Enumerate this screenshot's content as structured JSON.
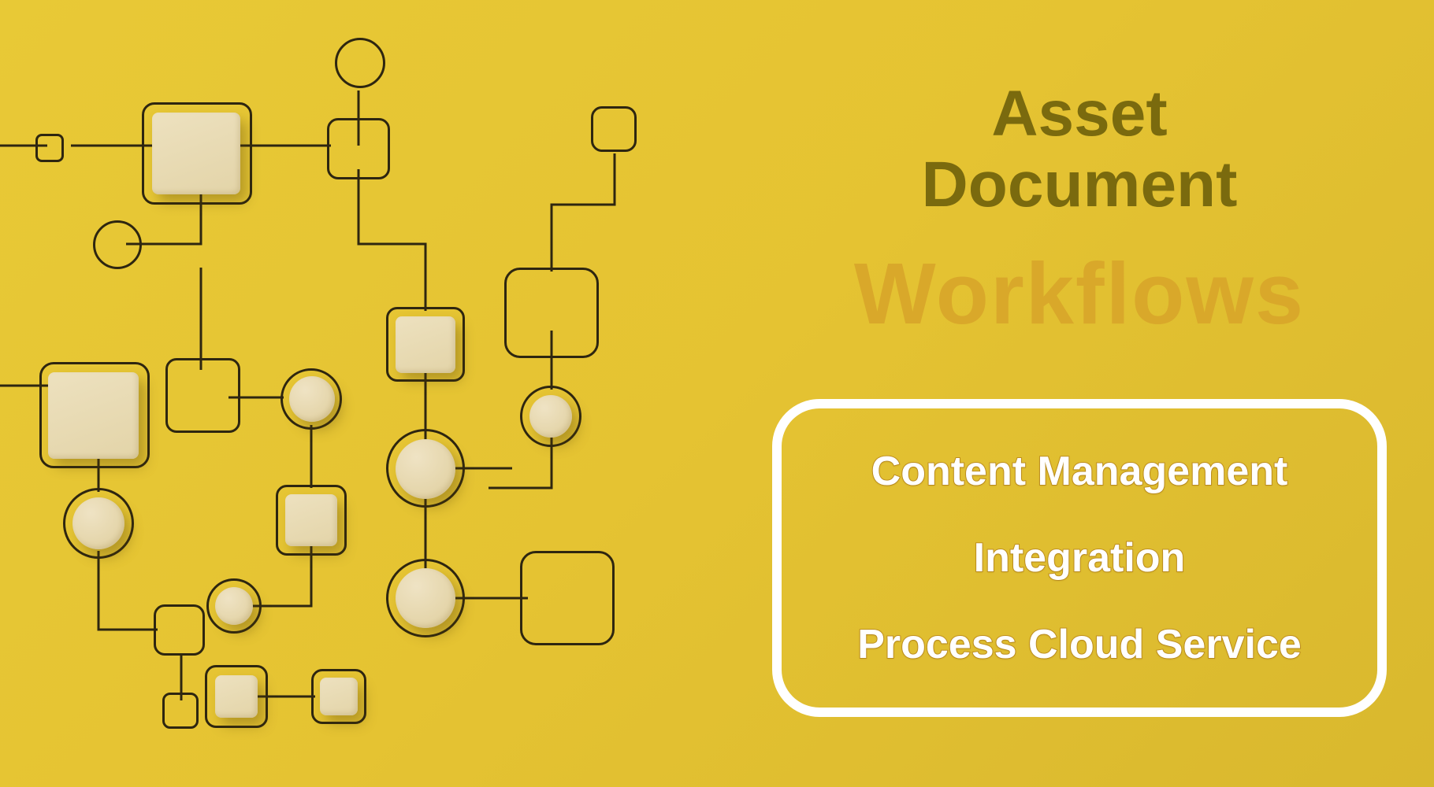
{
  "title": {
    "line1": "Asset",
    "line2": "Document",
    "workflows": "Workflows"
  },
  "features": {
    "item1": "Content Management",
    "item2": "Integration",
    "item3": "Process Cloud Service"
  },
  "colors": {
    "background": "#e5c332",
    "title_text": "#7a6a0e",
    "workflows_text": "#d9a82a",
    "box_border": "#ffffff",
    "feature_text": "#ffffff",
    "wood_block": "#e3d4a8",
    "outline": "#2e2610"
  }
}
